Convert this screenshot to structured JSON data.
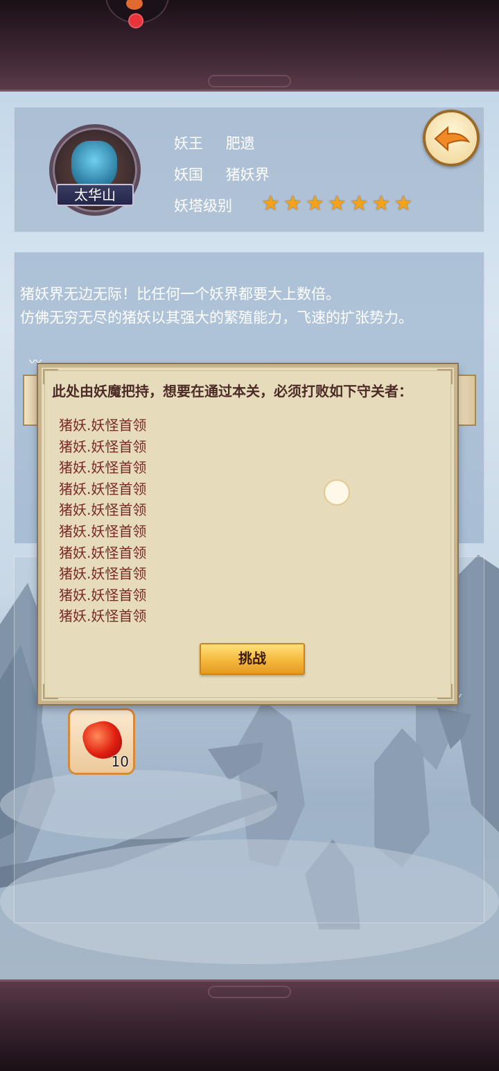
{
  "header": {
    "location_badge": "太华山",
    "demon_king_label": "妖王",
    "demon_king_value": "肥遗",
    "demon_realm_label": "妖国",
    "demon_realm_value": "猪妖界",
    "tower_level_label": "妖塔级别",
    "tower_level_stars": 7
  },
  "description": {
    "line1": "猪妖界无边无际！比任何一个妖界都要大上数倍。",
    "line2": "仿佛无穷无尽的猪妖以其强大的繁殖能力，飞速的扩张势力。"
  },
  "dialog": {
    "title": "此处由妖魔把持，想要在通过本关，必须打败如下守关者：",
    "guardians": [
      "猪妖.妖怪首领",
      "猪妖.妖怪首领",
      "猪妖.妖怪首领",
      "猪妖.妖怪首领",
      "猪妖.妖怪首领",
      "猪妖.妖怪首领",
      "猪妖.妖怪首领",
      "猪妖.妖怪首领",
      "猪妖.妖怪首领",
      "猪妖.妖怪首领"
    ],
    "challenge_button": "挑战"
  },
  "reward": {
    "icon": "red-gem-icon",
    "count": "10"
  },
  "colors": {
    "frame_dark": "#3a2430",
    "dialog_bg": "#e6dcbc",
    "dialog_title": "#4c2a26",
    "guardian_text": "#7a2a26",
    "button_gold": "#f4b93c",
    "star": "#f4a11c",
    "notification": "#e8333a"
  }
}
